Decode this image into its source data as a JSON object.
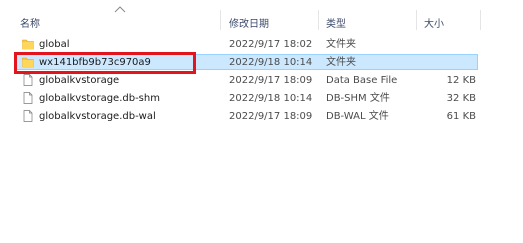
{
  "columns": {
    "name": "名称",
    "date": "修改日期",
    "type": "类型",
    "size": "大小"
  },
  "colors": {
    "folder": "#f7c548",
    "selection": "#cce8ff",
    "annotation": "#e2141e"
  },
  "files": [
    {
      "name": "global",
      "date": "2022/9/17 18:02",
      "type": "文件夹",
      "size": "",
      "icon": "folder-icon"
    },
    {
      "name": "wx141bfb9b73c970a9",
      "date": "2022/9/18 10:14",
      "type": "文件夹",
      "size": "",
      "icon": "folder-icon",
      "selected": true
    },
    {
      "name": "globalkvstorage",
      "date": "2022/9/17 18:09",
      "type": "Data Base File",
      "size": "12 KB",
      "icon": "file-icon"
    },
    {
      "name": "globalkvstorage.db-shm",
      "date": "2022/9/18 10:14",
      "type": "DB-SHM 文件",
      "size": "32 KB",
      "icon": "file-icon"
    },
    {
      "name": "globalkvstorage.db-wal",
      "date": "2022/9/17 18:09",
      "type": "DB-WAL 文件",
      "size": "61 KB",
      "icon": "file-icon"
    }
  ]
}
